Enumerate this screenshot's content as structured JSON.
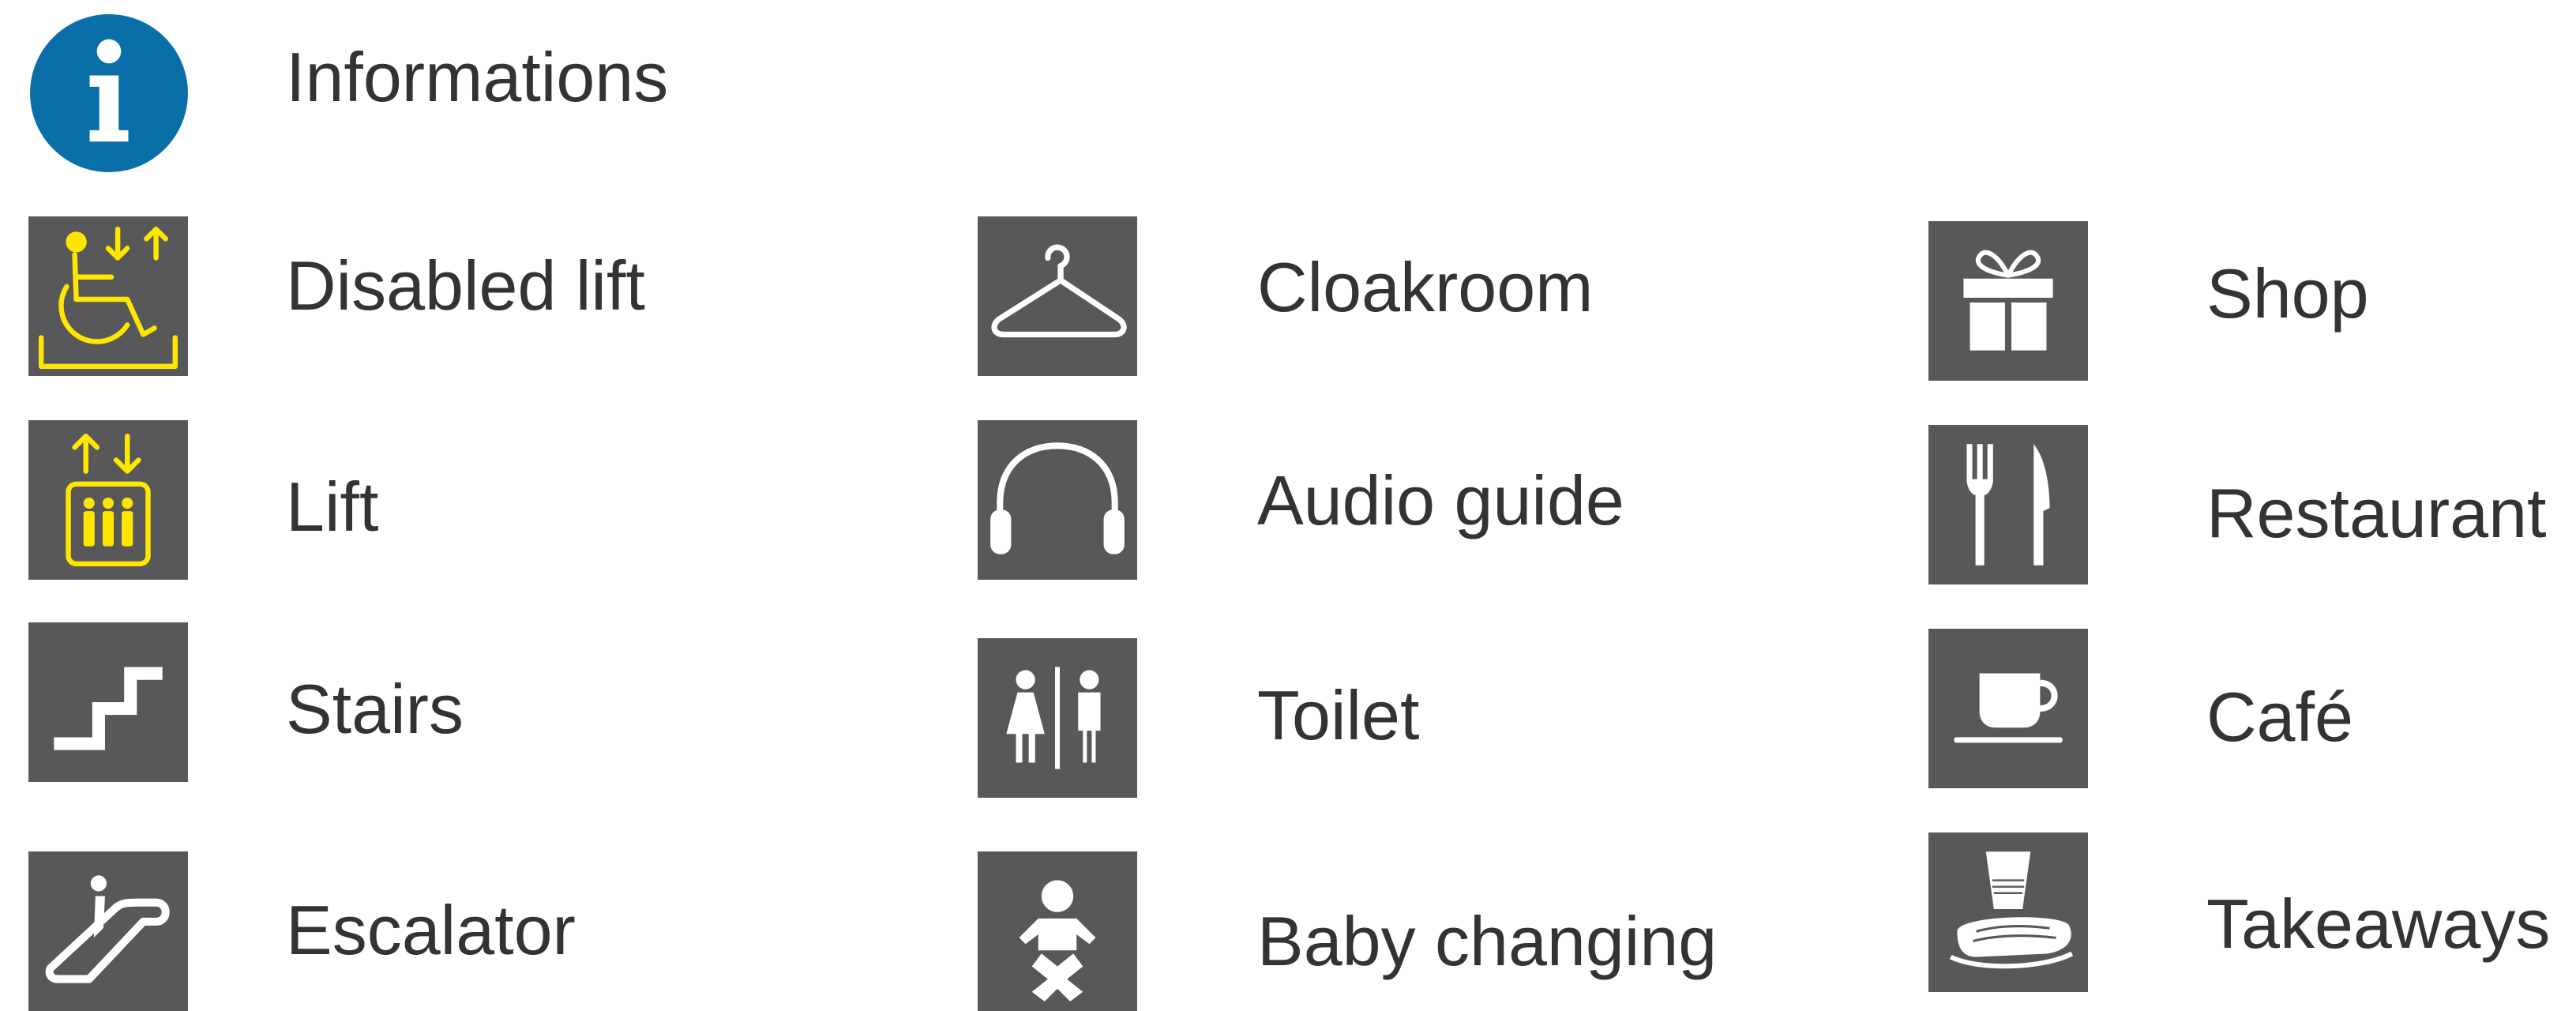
{
  "colors": {
    "icon_background": "#58585a",
    "icon_glyph": "#ffffff",
    "accessibility_glyph": "#ffe600",
    "info_circle": "#0a6ea8",
    "label_text": "#333333"
  },
  "info": {
    "label": "Informations",
    "icon": "info-icon"
  },
  "column_1": [
    {
      "label": "Disabled lift",
      "icon": "wheelchair-lift-icon"
    },
    {
      "label": "Lift",
      "icon": "lift-icon"
    },
    {
      "label": "Stairs",
      "icon": "stairs-icon"
    },
    {
      "label": "Escalator",
      "icon": "escalator-icon"
    }
  ],
  "column_2": [
    {
      "label": "Cloakroom",
      "icon": "hanger-icon"
    },
    {
      "label": "Audio guide",
      "icon": "headphones-icon"
    },
    {
      "label": "Toilet",
      "icon": "toilet-icon"
    },
    {
      "label": "Baby changing",
      "icon": "baby-changing-icon"
    }
  ],
  "column_3": [
    {
      "label": "Shop",
      "icon": "gift-icon"
    },
    {
      "label": "Restaurant",
      "icon": "cutlery-icon"
    },
    {
      "label": "Café",
      "icon": "coffee-cup-icon"
    },
    {
      "label": "Takeaways",
      "icon": "takeaway-icon"
    }
  ]
}
